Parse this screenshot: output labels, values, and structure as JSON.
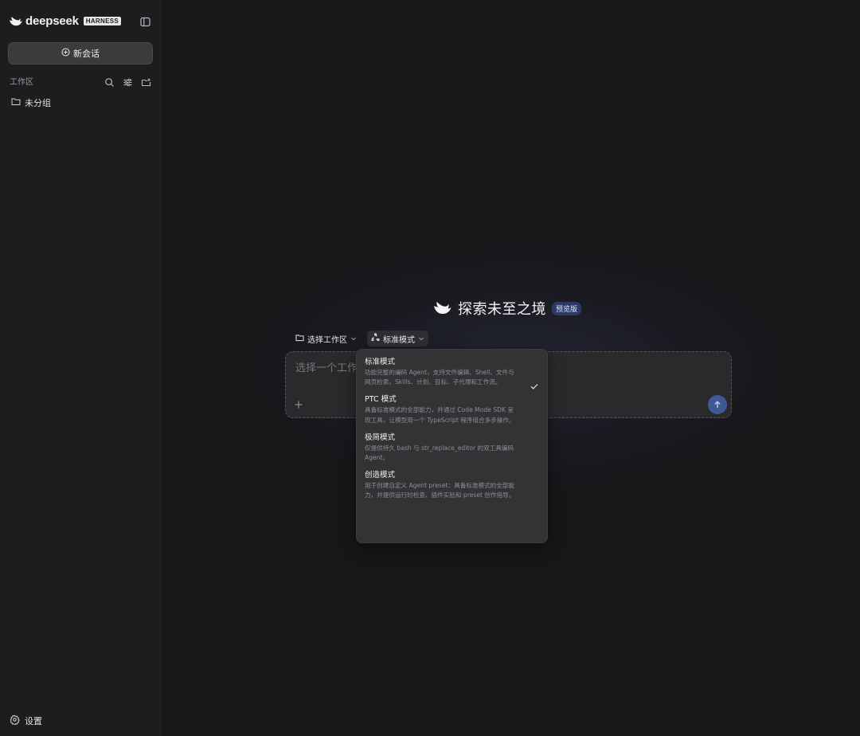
{
  "sidebar": {
    "brand_name": "deepseek",
    "brand_badge": "HARNESS",
    "new_chat_label": "新会话",
    "workspace_label": "工作区",
    "group_label": "未分组",
    "settings_label": "设置"
  },
  "main": {
    "hero_title": "探索未至之境",
    "hero_badge": "预览版",
    "workspace_selector": "选择工作区",
    "mode_selector": "标准模式",
    "input_placeholder": "选择一个工作区",
    "accent_color": "#3e5a94"
  },
  "dropdown": {
    "options": [
      {
        "title": "标准模式",
        "desc": "功能完整的编码 Agent，支持文件编辑、Shell、文件与网页检索、Skills、计划、目标、子代理和工作流。",
        "selected": true
      },
      {
        "title": "PTC 模式",
        "desc": "具备标准模式的全部能力，并通过 Code Mode SDK 呈现工具，让模型用一个 TypeScript 程序组合多步操作。",
        "selected": false
      },
      {
        "title": "极简模式",
        "desc": "仅提供持久 bash 与 str_replace_editor 的双工具编码 Agent。",
        "selected": false
      },
      {
        "title": "创造模式",
        "desc": "用于创建自定义 Agent preset：具备标准模式的全部能力，并提供运行时检查、插件实验和 preset 创作指导。",
        "selected": false
      }
    ]
  }
}
